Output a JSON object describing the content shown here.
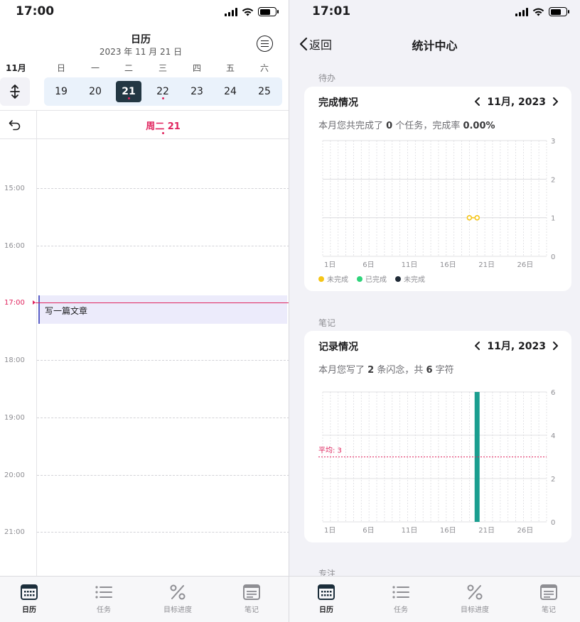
{
  "left": {
    "status": {
      "time": "17:00"
    },
    "header": {
      "title": "日历",
      "subtitle": "2023 年 11 月 21 日"
    },
    "month_label": "11月",
    "weekdays": [
      "日",
      "一",
      "二",
      "三",
      "四",
      "五",
      "六"
    ],
    "days": [
      "19",
      "20",
      "21",
      "22",
      "23",
      "24",
      "25"
    ],
    "selected_day": "21",
    "day_header": "周二 21",
    "hours": [
      "15:00",
      "16:00",
      "17:00",
      "18:00",
      "19:00",
      "20:00",
      "21:00"
    ],
    "event": {
      "title": "写一篇文章"
    }
  },
  "right": {
    "status": {
      "time": "17:01"
    },
    "nav": {
      "back": "返回",
      "title": "统计中心"
    },
    "sections": [
      "待办",
      "笔记",
      "专注"
    ],
    "tasks_card": {
      "title": "完成情况",
      "period": "11月, 2023",
      "desc_prefix": "本月您共完成了 ",
      "desc_count": "0",
      "desc_mid": " 个任务，完成率 ",
      "desc_rate": "0.00%",
      "legend": [
        "未完成",
        "已完成",
        "未完成"
      ],
      "legend_colors": [
        "#f5c518",
        "#2ed47a",
        "#1f2a36"
      ]
    },
    "notes_card": {
      "title": "记录情况",
      "period": "11月, 2023",
      "desc_prefix": "本月您写了 ",
      "desc_count": "2",
      "desc_mid": " 条闪念，共 ",
      "desc_chars": "6",
      "desc_suffix": " 字符",
      "avg_label": "平均: 3"
    }
  },
  "tabbar": {
    "items": [
      "日历",
      "任务",
      "目标进度",
      "笔记"
    ]
  },
  "chart_data": [
    {
      "type": "line",
      "title": "完成情况",
      "x_tick_labels": [
        "1日",
        "6日",
        "11日",
        "16日",
        "21日",
        "26日"
      ],
      "xlim": [
        1,
        30
      ],
      "ylim": [
        0,
        3
      ],
      "y_ticks": [
        0,
        1,
        2,
        3
      ],
      "series": [
        {
          "name": "未完成",
          "color": "#f5c518",
          "x": [
            20,
            21
          ],
          "y": [
            1,
            1
          ]
        },
        {
          "name": "已完成",
          "color": "#2ed47a",
          "x": [],
          "y": []
        },
        {
          "name": "未完成",
          "color": "#1f2a36",
          "x": [],
          "y": []
        }
      ]
    },
    {
      "type": "bar",
      "title": "记录情况",
      "x_tick_labels": [
        "1日",
        "6日",
        "11日",
        "16日",
        "21日",
        "26日"
      ],
      "xlim": [
        1,
        30
      ],
      "ylim": [
        0,
        6
      ],
      "y_ticks": [
        0,
        2,
        4,
        6
      ],
      "x": [
        21
      ],
      "values": [
        6
      ],
      "color": "#1a9e8f",
      "average": 3
    }
  ]
}
